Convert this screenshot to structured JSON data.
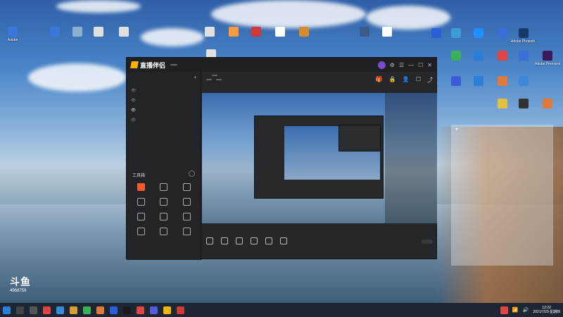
{
  "desktop": {
    "icons_left": [
      {
        "label": "Adobe",
        "color": "#3b77d8"
      },
      {
        "label": "",
        "color": "#3b77d8"
      },
      {
        "label": "",
        "color": "#8ab0d0"
      },
      {
        "label": "",
        "color": "#e0e0e0"
      },
      {
        "label": "",
        "color": "#e0e0e0"
      },
      {
        "label": "",
        "color": "#e0e0e0"
      },
      {
        "label": "",
        "color": "#ff9a3a"
      },
      {
        "label": "",
        "color": "#d23a3a"
      },
      {
        "label": "",
        "color": "#ffffff"
      },
      {
        "label": "",
        "color": "#d88c2c"
      },
      {
        "label": "",
        "color": "#3b5b8a"
      },
      {
        "label": "",
        "color": "#ffffff"
      },
      {
        "label": "",
        "color": "#e0e0e0"
      }
    ],
    "icons_right": [
      {
        "label": "",
        "color": "#2b5fd8"
      },
      {
        "label": "",
        "color": "#3b9cd8"
      },
      {
        "label": "",
        "color": "#1e90ff"
      },
      {
        "label": "",
        "color": "#3b6fd8"
      },
      {
        "label": "Adobe Photosh...",
        "color": "#1a3b6a"
      },
      {
        "label": "",
        "color": "#3bb05a"
      },
      {
        "label": "",
        "color": "#2b7fd8"
      },
      {
        "label": "",
        "color": "#e04444"
      },
      {
        "label": "",
        "color": "#3b6fd8"
      },
      {
        "label": "Adobe Premiere P...",
        "color": "#3a1a5a"
      },
      {
        "label": "",
        "color": "#3b5bd8"
      },
      {
        "label": "",
        "color": "#2b7fd8"
      },
      {
        "label": "",
        "color": "#e07a3a"
      },
      {
        "label": "",
        "color": "#3b8ad8"
      },
      {
        "label": "",
        "color": "#e0c040"
      },
      {
        "label": "",
        "color": "#333333"
      },
      {
        "label": "",
        "color": "#e07a3a"
      }
    ]
  },
  "app": {
    "name": "直播伴侣",
    "version": "",
    "tabs": [
      "",
      "",
      ""
    ],
    "scenes": [
      "",
      "",
      "",
      ""
    ],
    "tools_title": "工具箱",
    "tools": [
      "",
      "",
      "",
      "",
      "",
      "",
      "",
      "",
      "",
      "",
      "",
      ""
    ],
    "footer": "",
    "stream": {
      "line1": "",
      "id_text": "",
      "edit_btn": "",
      "tag1": "",
      "tag2": "",
      "stats": ""
    },
    "controls": [
      "",
      "",
      "",
      "",
      "",
      ""
    ],
    "start_label": "",
    "status": [
      "",
      "",
      ""
    ]
  },
  "right_panel": {
    "top_stats": [
      "",
      ""
    ],
    "lines": [
      "",
      "",
      "",
      "",
      "",
      "",
      ""
    ]
  },
  "watermark": {
    "big": "斗鱼",
    "mid": "",
    "num": "4968759"
  },
  "taskbar": {
    "time": "12:22",
    "date": "2021/7/29 星期四"
  }
}
